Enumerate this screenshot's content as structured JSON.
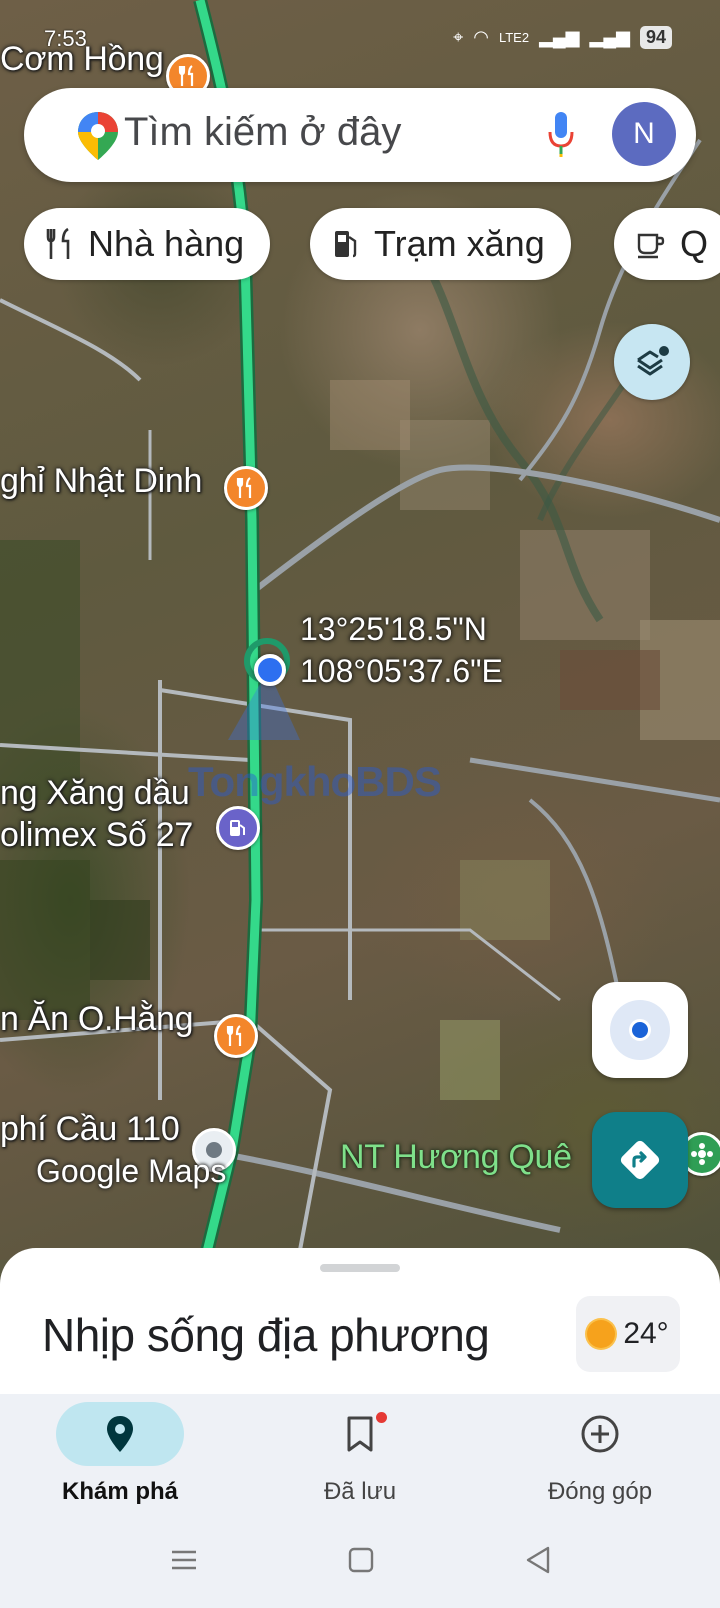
{
  "status_bar": {
    "time": "7:53",
    "battery": "94",
    "network": "LTE2"
  },
  "search": {
    "placeholder": "Tìm kiếm ở đây",
    "avatar_letter": "N"
  },
  "chips": [
    {
      "icon": "fork-knife-icon",
      "label": "Nhà hàng"
    },
    {
      "icon": "gas-station-icon",
      "label": "Trạm xăng"
    },
    {
      "icon": "coffee-cup-icon",
      "label": "Q"
    }
  ],
  "map": {
    "labels": {
      "com_hong": "Cơm Hồng",
      "nhat_dinh": "ghỉ Nhật Dinh",
      "xang_dau_1": "ng Xăng dầu",
      "xang_dau_2": "olimex Số 27",
      "o_hang": "n Ăn O.Hằng",
      "cau_110": "phí Cầu 110",
      "huong_que": "NT Hương Quê"
    },
    "coordinates": {
      "lat": "13°25'18.5\"N",
      "lng": "108°05'37.6\"E"
    },
    "attribution": "Google Maps",
    "watermark": "TongkhoBDS"
  },
  "sheet": {
    "title": "Nhịp sống địa phương",
    "temperature": "24°"
  },
  "nav": [
    {
      "icon": "explore-pin-icon",
      "label": "Khám phá",
      "active": true
    },
    {
      "icon": "bookmark-icon",
      "label": "Đã lưu",
      "active": false
    },
    {
      "icon": "add-circle-icon",
      "label": "Đóng góp",
      "active": false
    }
  ],
  "colors": {
    "road": "#2fd483",
    "accent": "#0f7f89",
    "pin_orange": "#f3862b"
  }
}
